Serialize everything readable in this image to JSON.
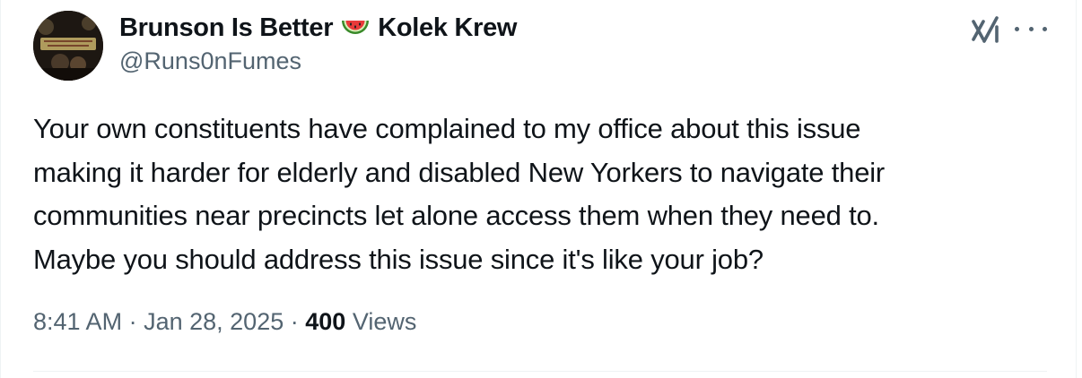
{
  "tweet": {
    "author": {
      "name_part1": "Brunson Is Better",
      "emoji": "watermelon-emoji",
      "name_part2": "Kolek Krew",
      "handle": "@Runs0nFumes",
      "avatar_icon": "profile-photo"
    },
    "text_lines": [
      "Your own constituents have complained to my office about this issue",
      "making it harder for elderly and disabled New Yorkers to navigate their",
      "communities near precincts let alone access them when they need to.",
      "Maybe you should address this issue since it's like your job?"
    ],
    "timestamp": "8:41 AM",
    "separator": "·",
    "date": "Jan 28, 2025",
    "views_count": "400",
    "views_label": "Views"
  },
  "icons": {
    "grok": "grok-icon",
    "more": "more-options-icon"
  },
  "colors": {
    "text_primary": "#0f1419",
    "text_secondary": "#536471",
    "divider": "#eff3f4"
  }
}
